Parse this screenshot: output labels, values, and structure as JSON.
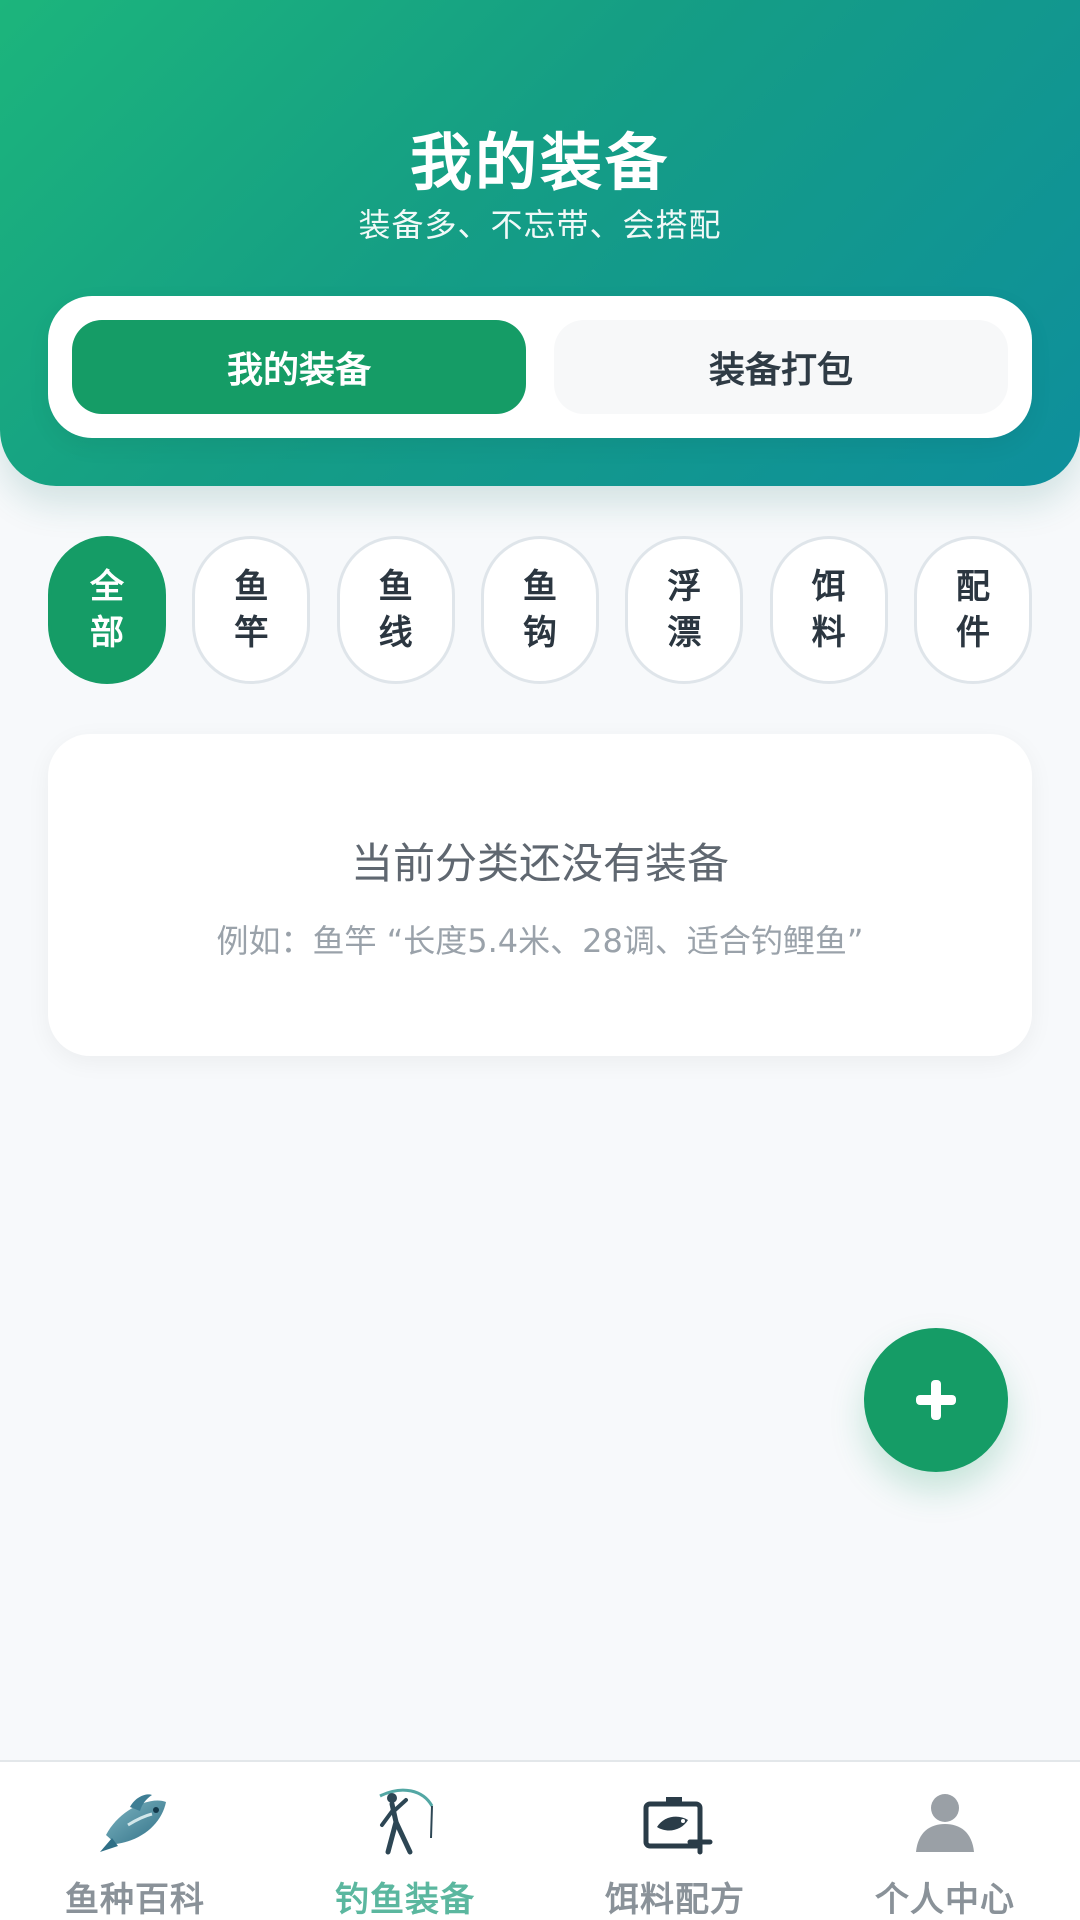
{
  "header": {
    "title": "我的装备",
    "subtitle": "装备多、不忘带、会搭配"
  },
  "segments": {
    "my_gear": "我的装备",
    "pack": "装备打包"
  },
  "categories": [
    {
      "top": "全",
      "bottom": "部"
    },
    {
      "top": "鱼",
      "bottom": "竿"
    },
    {
      "top": "鱼",
      "bottom": "线"
    },
    {
      "top": "鱼",
      "bottom": "钩"
    },
    {
      "top": "浮",
      "bottom": "漂"
    },
    {
      "top": "饵",
      "bottom": "料"
    },
    {
      "top": "配",
      "bottom": "件"
    }
  ],
  "empty_state": {
    "title": "当前分类还没有装备",
    "example": "例如：鱼竿 “长度5.4米、28调、适合钓鲤鱼”"
  },
  "fab": {
    "icon": "plus-icon"
  },
  "bottom_nav": [
    {
      "label": "鱼种百科",
      "icon": "fish-icon"
    },
    {
      "label": "钓鱼装备",
      "icon": "fishing-rod-icon"
    },
    {
      "label": "饵料配方",
      "icon": "bait-box-icon"
    },
    {
      "label": "个人中心",
      "icon": "user-icon"
    }
  ],
  "colors": {
    "accent": "#159c66",
    "header_start": "#1cb57c",
    "header_end": "#0e8f9c",
    "active_nav": "#5bb79f"
  }
}
